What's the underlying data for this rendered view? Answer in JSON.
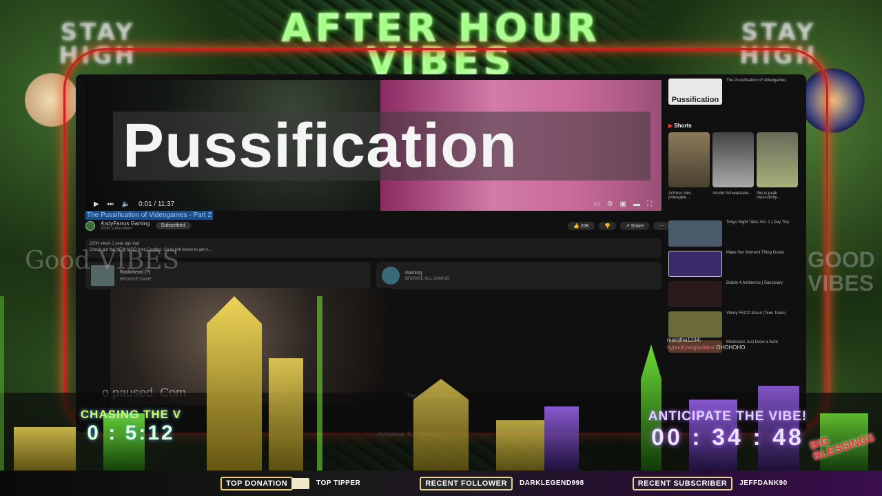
{
  "overlay": {
    "banner_line1": "AFTER HOUR",
    "banner_line2": "VIBES",
    "stay_high_left": "STAY HIGH",
    "stay_high_right": "STAY HIGH",
    "good_vibes_left": "Good VIBES",
    "good_vibes_right": "GOOD VIBES",
    "big_blessings": "BIG BLESSINGS"
  },
  "video": {
    "big_title": "Pussification",
    "time": "0:01 / 11:37",
    "title": "The Pussification of Videogames - Part 2",
    "channel": "AndyFarrus Gaming",
    "subscribers": "200K subscribers",
    "subscribe_label": "Subscribed",
    "likes": "20K",
    "share_label": "Share",
    "description": "220K views  1 year ago  #ad",
    "description_line2": "Check out the NEW MOD from Conflux. Go to link below to get it...",
    "card1_title": "Radiohead (?)",
    "card1_sub": "BROWSE GAME",
    "card2_title": "Gaming",
    "card2_sub": "BROWSE ALL GAMING"
  },
  "sidebar": {
    "top_card_title": "Pussification",
    "top_card_caption": "The Pussification of Videogames",
    "shorts_label": "Shorts",
    "shorts": [
      {
        "caption": "Actress tries pineapple..."
      },
      {
        "caption": "Arnold Schwarzene..."
      },
      {
        "caption": "this is peak masculinity..."
      }
    ],
    "videos": [
      {
        "caption": "Tokyo Night Tales Vol. 1 | Day Trip"
      },
      {
        "caption": "Make Her Moment Thing Guide"
      },
      {
        "caption": "Diablo 4 Ambience | Sanctuary"
      },
      {
        "caption": "Vlinny FECO Scout (Teen Team)"
      },
      {
        "caption": "Moderator Just Drew a Note"
      }
    ]
  },
  "chat": {
    "user1": "marqtha1234:",
    "user2": "hypnolizedgladiator",
    "msg": "OHOHOHO"
  },
  "stream": {
    "paused_text": "o paused. Com",
    "pause_msg": "The r... 4:20 will be in",
    "location": "Ashgabat, K...          Island, A...",
    "left_timer_label": "CHASING THE V",
    "left_timer_value": "0 : 5:12",
    "right_timer_label": "ANTICIPATE THE VIBE!",
    "right_timer_value": "00 : 34 : 48"
  },
  "bottom_bar": {
    "top_donation_label": "TOP DONATION",
    "top_tipper_label": "TOP TIPPER",
    "recent_follower_label": "RECENT FOLLOWER",
    "recent_follower_value": "DARKLEGEND998",
    "recent_subscriber_label": "RECENT SUBSCRIBER",
    "recent_subscriber_value": "JEFFDANK90"
  },
  "colors": {
    "frame_red": "#c3221f",
    "neon_green": "#6cff3c",
    "purple": "#a66cff"
  }
}
